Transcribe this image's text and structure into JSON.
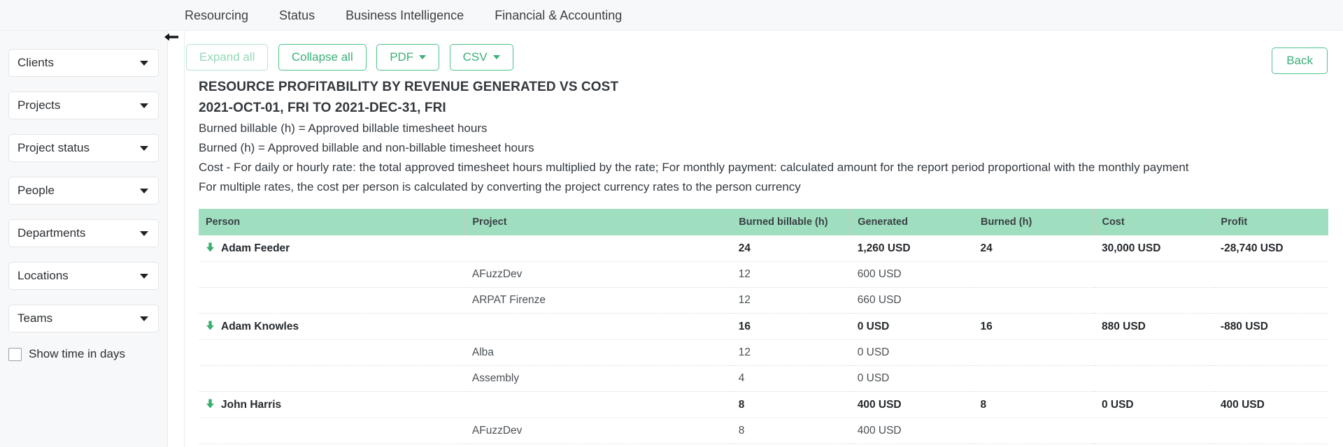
{
  "topnav": {
    "items": [
      {
        "label": "Resourcing"
      },
      {
        "label": "Status"
      },
      {
        "label": "Business Intelligence"
      },
      {
        "label": "Financial & Accounting"
      }
    ]
  },
  "sidebar": {
    "filters": [
      {
        "label": "Clients"
      },
      {
        "label": "Projects"
      },
      {
        "label": "Project status"
      },
      {
        "label": "People"
      },
      {
        "label": "Departments"
      },
      {
        "label": "Locations"
      },
      {
        "label": "Teams"
      }
    ],
    "checkbox": {
      "label": "Show time in days",
      "checked": false
    },
    "collapse_icon": "arrow-left-icon"
  },
  "toolbar": {
    "expand_all": "Expand all",
    "collapse_all": "Collapse all",
    "pdf": "PDF",
    "csv": "CSV",
    "back": "Back"
  },
  "report": {
    "title": "RESOURCE PROFITABILITY BY REVENUE GENERATED VS COST",
    "subtitle": "2021-OCT-01, FRI TO 2021-DEC-31, FRI",
    "notes": [
      "Burned billable (h) = Approved billable timesheet hours",
      "Burned (h) = Approved billable and non-billable timesheet hours",
      "Cost - For daily or hourly rate: the total approved timesheet hours multiplied by the rate; For monthly payment: calculated amount for the report period proportional with the monthly payment",
      "For multiple rates, the cost per person is calculated by converting the project currency rates to the person currency"
    ]
  },
  "table": {
    "columns": [
      "Person",
      "Project",
      "Burned billable (h)",
      "Generated",
      "Burned (h)",
      "Cost",
      "Profit"
    ],
    "rows": [
      {
        "type": "person",
        "person": "Adam Feeder",
        "project": "",
        "burned_billable": "24",
        "generated": "1,260 USD",
        "burned": "24",
        "cost": "30,000 USD",
        "profit": "-28,740 USD"
      },
      {
        "type": "project",
        "person": "",
        "project": "AFuzzDev",
        "burned_billable": "12",
        "generated": "600 USD",
        "burned": "",
        "cost": "",
        "profit": ""
      },
      {
        "type": "project",
        "person": "",
        "project": "ARPAT Firenze",
        "burned_billable": "12",
        "generated": "660 USD",
        "burned": "",
        "cost": "",
        "profit": ""
      },
      {
        "type": "person",
        "person": "Adam Knowles",
        "project": "",
        "burned_billable": "16",
        "generated": "0 USD",
        "burned": "16",
        "cost": "880 USD",
        "profit": "-880 USD"
      },
      {
        "type": "project",
        "person": "",
        "project": "Alba",
        "burned_billable": "12",
        "generated": "0 USD",
        "burned": "",
        "cost": "",
        "profit": ""
      },
      {
        "type": "project",
        "person": "",
        "project": "Assembly",
        "burned_billable": "4",
        "generated": "0 USD",
        "burned": "",
        "cost": "",
        "profit": ""
      },
      {
        "type": "person",
        "person": "John Harris",
        "project": "",
        "burned_billable": "8",
        "generated": "400 USD",
        "burned": "8",
        "cost": "0 USD",
        "profit": "400 USD"
      },
      {
        "type": "project",
        "person": "",
        "project": "AFuzzDev",
        "burned_billable": "8",
        "generated": "400 USD",
        "burned": "",
        "cost": "",
        "profit": ""
      }
    ]
  },
  "colors": {
    "accent_green": "#3bb078",
    "header_green": "#9fdfc0",
    "panel_grey": "#f7f8f9",
    "arrow_green": "#3aaf6d"
  }
}
